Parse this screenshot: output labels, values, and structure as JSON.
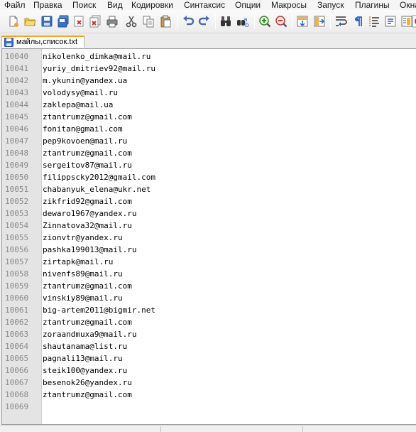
{
  "menu": [
    "Файл",
    "Правка",
    "Поиск",
    "Вид",
    "Кодировки",
    "Синтаксис",
    "Опции",
    "Макросы",
    "Запуск",
    "Плагины",
    "Окна"
  ],
  "tab": {
    "label": "майлы,список.txt"
  },
  "editor": {
    "lines": [
      {
        "n": "10040",
        "text": "nikolenko_dimka@mail.ru"
      },
      {
        "n": "10041",
        "text": "yuriy_dmitriev92@mail.ru"
      },
      {
        "n": "10042",
        "text": "m.ykunin@yandex.ua"
      },
      {
        "n": "10043",
        "text": "volodysy@mail.ru"
      },
      {
        "n": "10044",
        "text": "zaklepa@mail.ua"
      },
      {
        "n": "10045",
        "text": "ztantrumz@gmail.com"
      },
      {
        "n": "10046",
        "text": "fonitan@gmail.com"
      },
      {
        "n": "10047",
        "text": "pep9kovoen@mail.ru"
      },
      {
        "n": "10048",
        "text": "ztantrumz@gmail.com"
      },
      {
        "n": "10049",
        "text": "sergeitov87@mail.ru"
      },
      {
        "n": "10050",
        "text": "filippscky2012@gmail.com"
      },
      {
        "n": "10051",
        "text": "chabanyuk_elena@ukr.net"
      },
      {
        "n": "10052",
        "text": "zikfrid92@gmail.com"
      },
      {
        "n": "10053",
        "text": "dewaro1967@yandex.ru"
      },
      {
        "n": "10054",
        "text": "Zinnatova32@mail.ru"
      },
      {
        "n": "10055",
        "text": "zionvtr@yandex.ru"
      },
      {
        "n": "10056",
        "text": "pashka199013@mail.ru"
      },
      {
        "n": "10057",
        "text": "zirtapk@mail.ru"
      },
      {
        "n": "10058",
        "text": "nivenfs89@mail.ru"
      },
      {
        "n": "10059",
        "text": "ztantrumz@gmail.com"
      },
      {
        "n": "10060",
        "text": "vinskiy89@mail.ru"
      },
      {
        "n": "10061",
        "text": "big-artem2011@bigmir.net"
      },
      {
        "n": "10062",
        "text": "ztantrumz@gmail.com"
      },
      {
        "n": "10063",
        "text": "zoraandmuxa9@mail.ru"
      },
      {
        "n": "10064",
        "text": "shautanama@list.ru"
      },
      {
        "n": "10065",
        "text": "pagnali13@mail.ru"
      },
      {
        "n": "10066",
        "text": "steik100@yandex.ru"
      },
      {
        "n": "10067",
        "text": "besenok26@yandex.ru"
      },
      {
        "n": "10068",
        "text": "ztantrumz@gmail.com"
      },
      {
        "n": "10069",
        "text": ""
      }
    ]
  },
  "toolbar": {
    "buttons": [
      "new-file-icon",
      "open-file-icon",
      "save-icon",
      "save-all-icon",
      "close-icon",
      "close-all-icon",
      "print-icon",
      "cut-icon",
      "copy-icon",
      "paste-icon",
      "undo-icon",
      "redo-icon",
      "find-icon",
      "replace-icon",
      "zoom-in-icon",
      "zoom-out-icon",
      "sync-vertical-icon",
      "sync-horizontal-icon",
      "word-wrap-icon",
      "show-all-characters-icon",
      "indent-guide-icon",
      "language-icon",
      "doc-map-icon",
      "record-macro-icon"
    ]
  },
  "colors": {
    "tab_accent": "#f5a623",
    "gutter_bg": "#e4e4e4",
    "line_number": "#8a8a8a",
    "text": "#000000"
  }
}
